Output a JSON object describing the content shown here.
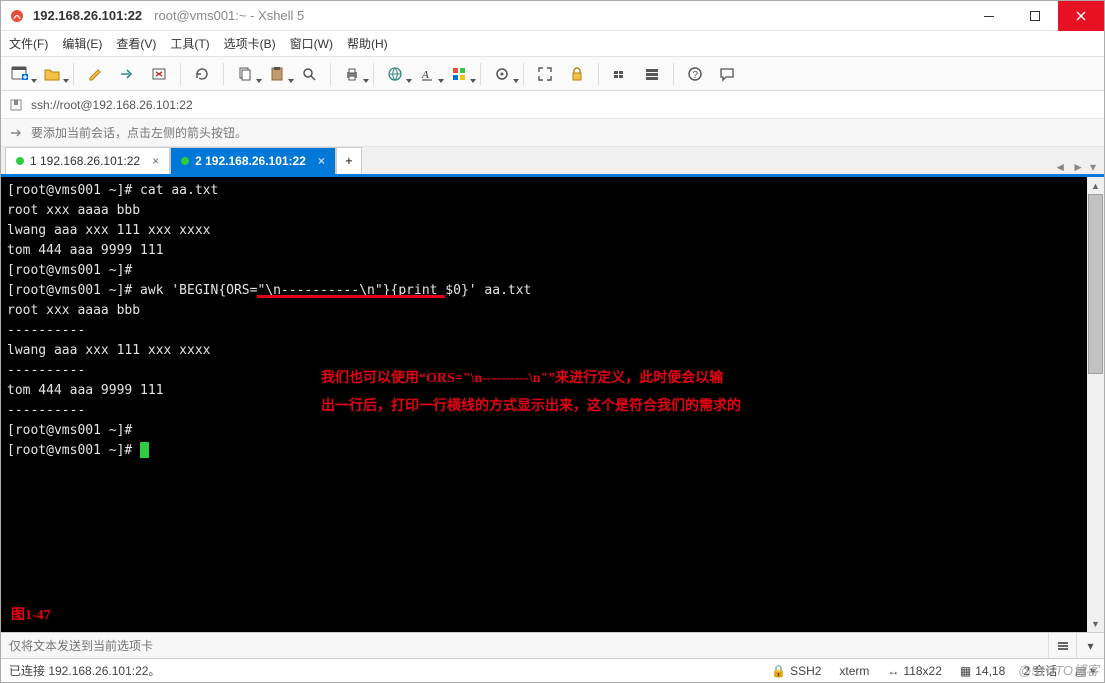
{
  "titlebar": {
    "host": "192.168.26.101:22",
    "subtitle": "root@vms001:~ - Xshell 5"
  },
  "menu": {
    "file": "文件(F)",
    "edit": "编辑(E)",
    "view": "查看(V)",
    "tools": "工具(T)",
    "tabs": "选项卡(B)",
    "window": "窗口(W)",
    "help": "帮助(H)"
  },
  "toolbar_names": [
    "new-session",
    "open",
    "save",
    "connect",
    "disconnect",
    "reconnect",
    "copy",
    "paste",
    "find",
    "print",
    "printer-settings",
    "font",
    "color-scheme",
    "encoding",
    "transfer",
    "run-script",
    "x-forward",
    "fullscreen",
    "transparency",
    "ascii",
    "hex",
    "always-on-top",
    "chat"
  ],
  "addressbar": {
    "url": "ssh://root@192.168.26.101:22"
  },
  "hint": {
    "text": "要添加当前会话，点击左侧的箭头按钮。"
  },
  "tabs": [
    {
      "label": "1 192.168.26.101:22",
      "active": false
    },
    {
      "label": "2 192.168.26.101:22",
      "active": true
    }
  ],
  "terminal": {
    "lines": [
      "[root@vms001 ~]# cat aa.txt",
      "root xxx aaaa bbb",
      "lwang aaa xxx 111 xxx xxxx",
      "tom 444 aaa 9999 111",
      "[root@vms001 ~]#",
      "[root@vms001 ~]# awk 'BEGIN{ORS=\"\\n----------\\n\"}{print $0}' aa.txt",
      "root xxx aaaa bbb",
      "----------",
      "lwang aaa xxx 111 xxx xxxx",
      "----------",
      "tom 444 aaa 9999 111",
      "----------",
      "[root@vms001 ~]#",
      "[root@vms001 ~]# "
    ],
    "annotation_line1": "我们也可以使用“ORS=\"\\n----------\\n\"”来进行定义，此时便会以输",
    "annotation_line2": "出一行后，打印一行横线的方式显示出来，这个是符合我们的需求的",
    "figure_label": "图1-47"
  },
  "inputbar": {
    "placeholder": "仅将文本发送到当前选项卡"
  },
  "statusbar": {
    "conn": "已连接 192.168.26.101:22。",
    "proto": "SSH2",
    "term": "xterm",
    "size": "118x22",
    "cursor": "14,18",
    "sessions": "2 会话"
  },
  "watermark": "@51CTO博客"
}
